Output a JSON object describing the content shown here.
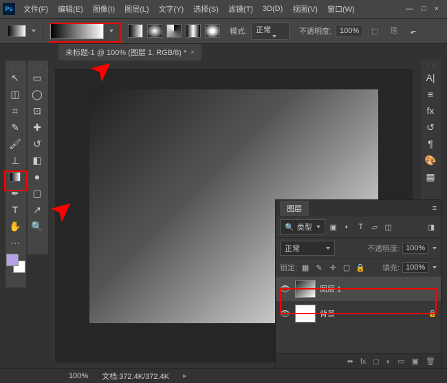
{
  "app": {
    "logo": "Ps"
  },
  "menu": {
    "items": [
      "文件(F)",
      "编辑(E)",
      "图像(I)",
      "图层(L)",
      "文字(Y)",
      "选择(S)",
      "滤镜(T)",
      "3D(D)",
      "视图(V)",
      "窗口(W)"
    ]
  },
  "options": {
    "mode_label": "模式:",
    "mode_value": "正常",
    "opacity_label": "不透明度:",
    "opacity_value": "100%"
  },
  "doc": {
    "tab_title": "未标题-1 @ 100% (图层 1, RGB/8) *",
    "close": "×"
  },
  "layers": {
    "title": "图层",
    "kind_label": "类型",
    "blend_value": "正常",
    "opacity_label": "不透明度:",
    "opacity_value": "100%",
    "lock_label": "锁定:",
    "fill_label": "填充:",
    "fill_value": "100%",
    "items": [
      {
        "name": "图层 1",
        "locked": false
      },
      {
        "name": "背景",
        "locked": true
      }
    ]
  },
  "status": {
    "zoom": "100%",
    "docinfo": "文档:372.4K/372.4K"
  }
}
